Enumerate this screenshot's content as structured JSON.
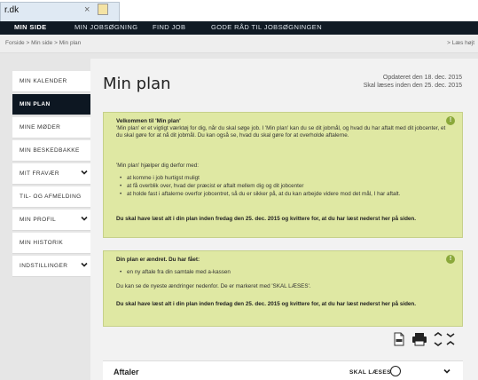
{
  "browser": {
    "tab_title": "r.dk",
    "close_glyph": "×"
  },
  "topnav": {
    "items": [
      "MIN SIDE",
      "MIN JOBSØGNING",
      "FIND JOB",
      "GODE RÅD TIL JOBSØGNINGEN"
    ]
  },
  "breadcrumb": {
    "path": "Forside > Min side > Min plan",
    "read_help": "> Læs højt"
  },
  "sidebar": {
    "items": [
      {
        "label": "MIN KALENDER",
        "expandable": false
      },
      {
        "label": "MIN PLAN",
        "expandable": false,
        "active": true
      },
      {
        "label": "MINE MØDER",
        "expandable": false
      },
      {
        "label": "MIN BESKEDBAKKE",
        "expandable": false
      },
      {
        "label": "MIT FRAVÆR",
        "expandable": true
      },
      {
        "label": "TIL- OG AFMELDING",
        "expandable": false
      },
      {
        "label": "MIN PROFIL",
        "expandable": true
      },
      {
        "label": "MIN HISTORIK",
        "expandable": false
      },
      {
        "label": "INDSTILLINGER",
        "expandable": true
      }
    ]
  },
  "main": {
    "title": "Min plan",
    "updated": "Opdateret den 18. dec. 2015",
    "read_by": "Skal læses inden den 25. dec. 2015"
  },
  "welcome_box": {
    "heading": "Velkommen til 'Min plan'",
    "intro": "'Min plan' er et vigtigt værktøj for dig, når du skal søge job. I 'Min plan' kan du se dit jobmål, og hvad du har aftalt med dit jobcenter, et du skal gøre for at nå dit jobmål. Du kan også se, hvad du skal gøre for at overholde aftalerne.",
    "helps_intro": "'Min plan' hjælper dig derfor med:",
    "bullets": [
      "at komme i job hurtigst muligt",
      "at få overblik over, hvad der præcist er aftalt mellem dig og dit jobcenter",
      "at holde fast i aftalerne overfor jobcentret, så du er sikker på, at du kan arbejde videre mod det mål, I har aftalt."
    ],
    "deadline": "Du skal have læst alt i din plan inden fredag den 25. dec. 2015 og kvittere for, at du har læst nederst her på siden."
  },
  "change_box": {
    "heading": "Din plan er ændret. Du har fået:",
    "bullets": [
      "en ny aftale fra din samtale med a-kassen"
    ],
    "note": "Du kan se de nyeste ændringer nedenfor. De er markeret med 'SKAL LÆSES'.",
    "deadline": "Du skal have læst alt i din plan inden fredag den 25. dec. 2015 og kvittere for, at du har læst nederst her på siden."
  },
  "section": {
    "title": "Aftaler",
    "status": "SKAL LÆSES"
  },
  "colors": {
    "nav": "#101a24",
    "active": "#0d1722",
    "infobox": "#dfe8a3",
    "info_icon": "#8aa83a"
  }
}
